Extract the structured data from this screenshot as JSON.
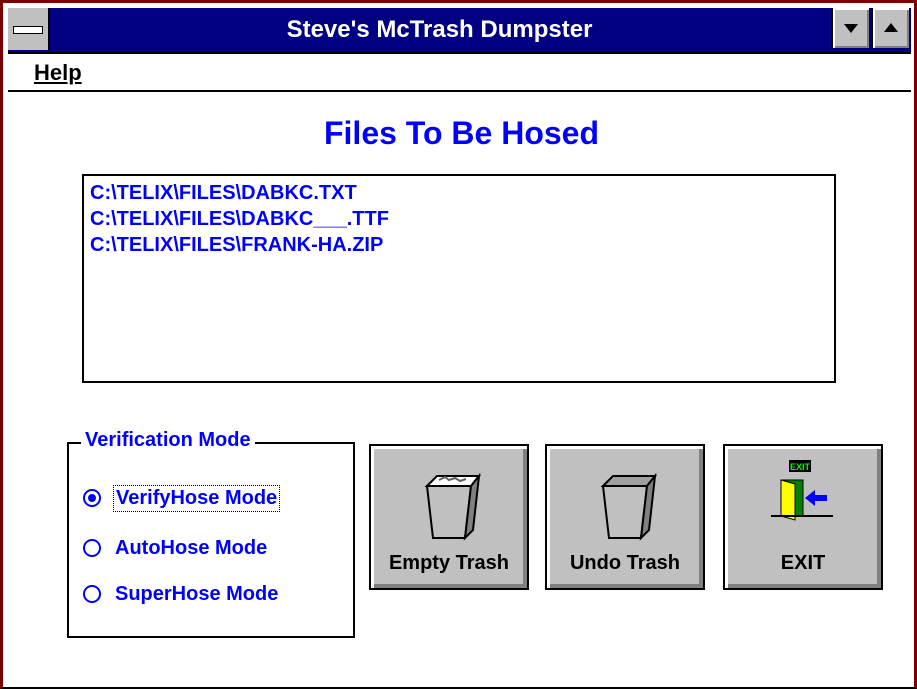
{
  "window": {
    "title": "Steve's McTrash Dumpster"
  },
  "menu": {
    "help": "Help"
  },
  "heading": "Files To Be Hosed",
  "files": [
    "C:\\TELIX\\FILES\\DABKC.TXT",
    "C:\\TELIX\\FILES\\DABKC___.TTF",
    "C:\\TELIX\\FILES\\FRANK-HA.ZIP"
  ],
  "verification": {
    "legend": "Verification Mode",
    "options": [
      {
        "label": "VerifyHose Mode",
        "selected": true
      },
      {
        "label": "AutoHose Mode",
        "selected": false
      },
      {
        "label": "SuperHose Mode",
        "selected": false
      }
    ]
  },
  "buttons": {
    "empty": "Empty Trash",
    "undo": "Undo Trash",
    "exit": "EXIT",
    "exit_sign": "EXIT"
  },
  "colors": {
    "title_bar": "#000080",
    "accent_text": "#0000ff",
    "button_face": "#c0c0c0",
    "window_frame": "#7a0000"
  },
  "icons": [
    "system-menu-icon",
    "minimize-icon",
    "maximize-icon",
    "trash-can-full-icon",
    "trash-can-empty-icon",
    "exit-door-icon"
  ]
}
